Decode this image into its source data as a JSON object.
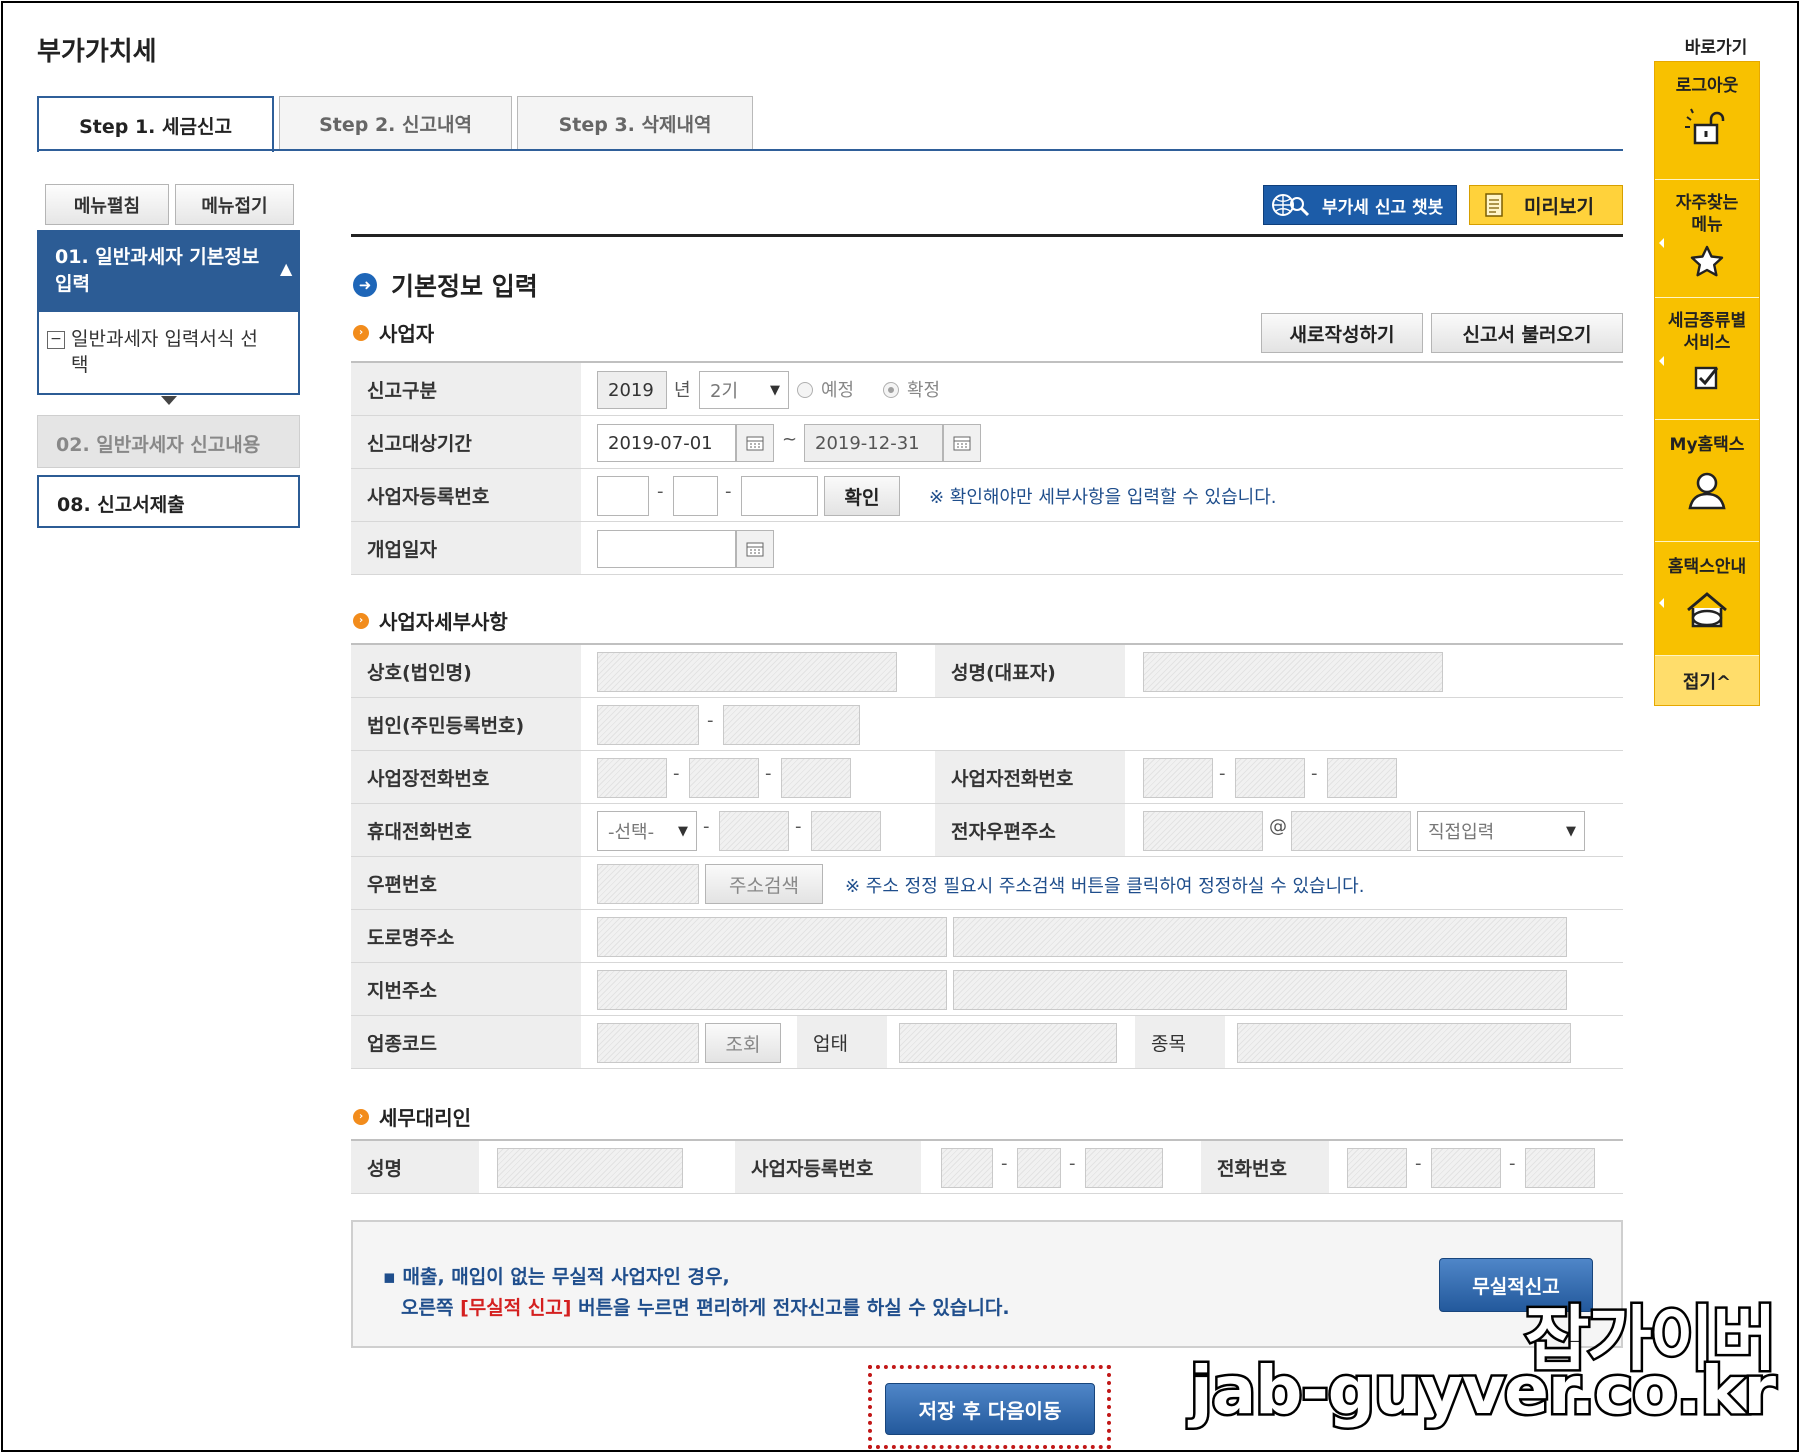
{
  "page": {
    "title": "부가가치세"
  },
  "tabs": [
    {
      "label": "Step 1. 세금신고"
    },
    {
      "label": "Step 2. 신고내역"
    },
    {
      "label": "Step 3. 삭제내역"
    }
  ],
  "side_menu": {
    "expand_label": "메뉴펼침",
    "collapse_label": "메뉴접기",
    "step01": {
      "label": "01. 일반과세자 기본정보 입력",
      "sub": "일반과세자 입력서식 선택"
    },
    "step02": {
      "label": "02. 일반과세자 신고내용"
    },
    "step08": {
      "label": "08. 신고서제출"
    }
  },
  "toolbar": {
    "chatbot_label": "부가세 신고 챗봇",
    "preview_label": "미리보기"
  },
  "section": {
    "title": "기본정보 입력"
  },
  "business": {
    "title": "사업자",
    "new_label": "새로작성하기",
    "load_label": "신고서 불러오기",
    "report_type": {
      "label": "신고구분",
      "year": "2019",
      "year_unit": "년",
      "period": "2기",
      "opt1": "예정",
      "opt2": "확정"
    },
    "period": {
      "label": "신고대상기간",
      "from": "2019-07-01",
      "tilde": "~",
      "to": "2019-12-31"
    },
    "reg_no": {
      "label": "사업자등록번호",
      "confirm_label": "확인",
      "note": "※ 확인해야만 세부사항을 입력할 수 있습니다."
    },
    "open_date": {
      "label": "개업일자"
    }
  },
  "details": {
    "title": "사업자세부사항",
    "company": "상호(법인명)",
    "rep_name": "성명(대표자)",
    "corp_id": "법인(주민등록번호)",
    "biz_phone": "사업장전화번호",
    "owner_phone": "사업자전화번호",
    "mobile": "휴대전화번호",
    "mobile_select": "-선택-",
    "email": "전자우편주소",
    "email_at": "@",
    "email_select": "직접입력",
    "zip": "우편번호",
    "zip_btn": "주소검색",
    "zip_note": "※ 주소 정정 필요시 주소검색 버튼을 클릭하여 정정하실 수 있습니다.",
    "road_addr": "도로명주소",
    "lot_addr": "지번주소",
    "industry_code": "업종코드",
    "lookup_btn": "조회",
    "biz_type": "업태",
    "biz_item": "종목"
  },
  "agent": {
    "title": "세무대리인",
    "name": "성명",
    "reg_no": "사업자등록번호",
    "phone": "전화번호"
  },
  "notice": {
    "line1": "▪ 매출, 매입이 없는 무실적 사업자인 경우,",
    "line2a": "오른쪽",
    "line2b": "[무실적 신고]",
    "line2c": "버튼을 누르면 편리하게 전자신고를 하실 수 있습니다.",
    "nil_button": "무실적신고"
  },
  "save_button": "저장 후 다음이동",
  "quick": {
    "title": "바로가기",
    "logout": "로그아웃",
    "favorites": "자주찾는 메뉴",
    "tax_service": "세금종류별 서비스",
    "my_hometax": "My홈택스",
    "hometax_guide": "홈택스안내",
    "fold": "접기^"
  },
  "watermark": {
    "line1": "잡가이버",
    "line2": "jab-guyver.co.kr"
  }
}
